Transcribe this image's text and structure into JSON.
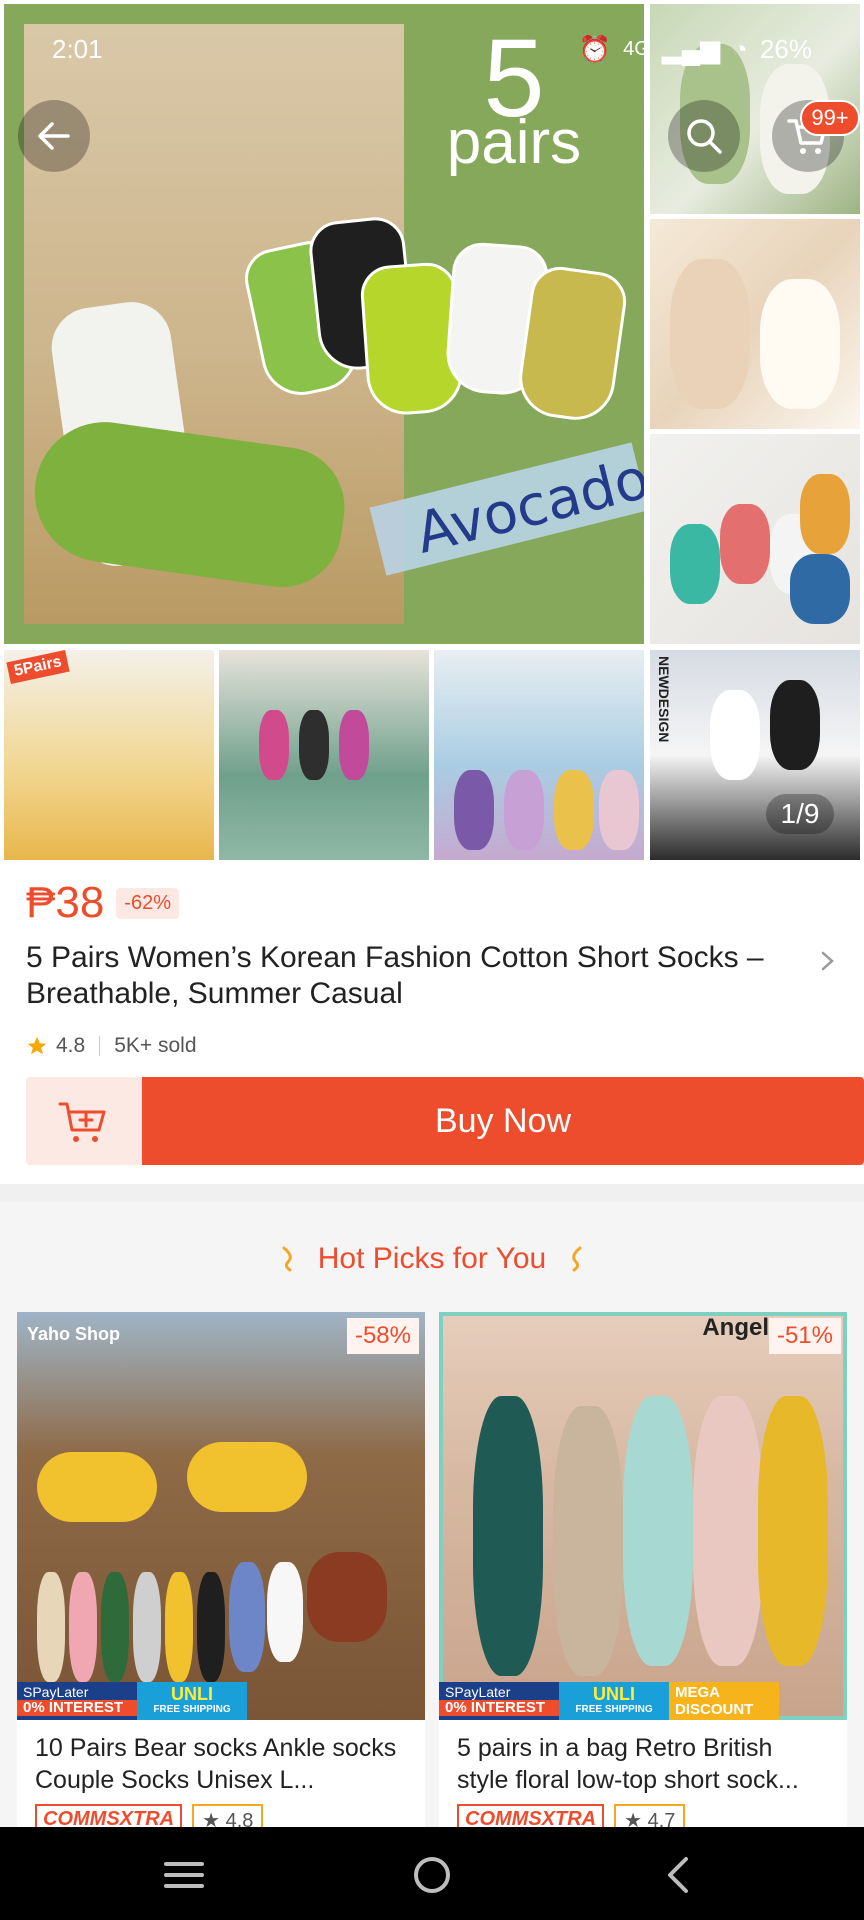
{
  "status_bar": {
    "time": "2:01",
    "network": "4G",
    "battery": "26%"
  },
  "gallery": {
    "main_title_number": "5",
    "main_title_word": "pairs",
    "main_label": "Avocado",
    "thumb_badge": "5Pairs",
    "new_design": "NEWDESIGN",
    "counter": "1/9"
  },
  "nav": {
    "cart_badge": "99+"
  },
  "product": {
    "price": "₱38",
    "discount": "-62%",
    "title": "5 Pairs Women’s Korean Fashion Cotton Short Socks – Breathable, Summer Casual",
    "rating": "4.8",
    "sold": "5K+ sold",
    "buy_label": "Buy Now"
  },
  "hot_picks": {
    "heading": "Hot Picks for You",
    "cards": [
      {
        "shop": "Yaho Shop",
        "discount": "-58%",
        "promo_paylater": "SPayLater",
        "promo_interest": "0% INTEREST",
        "promo_unli": "UNLI",
        "promo_shipping": "FREE SHIPPING",
        "title": "10 Pairs Bear socks Ankle socks Couple Socks Unisex L...",
        "tag": "COMMSXTRA",
        "rating": "4.8"
      },
      {
        "shop": "Angel",
        "discount": "-51%",
        "promo_paylater": "SPayLater",
        "promo_interest": "0% INTEREST",
        "promo_unli": "UNLI",
        "promo_shipping": "FREE SHIPPING",
        "promo_mega": "MEGA DISCOUNT",
        "title": "5 pairs in a bag Retro British style floral low-top short sock...",
        "tag": "COMMSXTRA",
        "rating": "4.7"
      }
    ]
  },
  "colors": {
    "accent": "#ee4d2d",
    "accent_light": "#fde9e4",
    "gallery_green": "#86a85a"
  },
  "icons": [
    "back-arrow-icon",
    "search-icon",
    "cart-icon",
    "add-to-cart-icon",
    "star-icon",
    "chevron-right-icon",
    "menu-icon",
    "home-circle-icon",
    "back-chevron-icon"
  ]
}
